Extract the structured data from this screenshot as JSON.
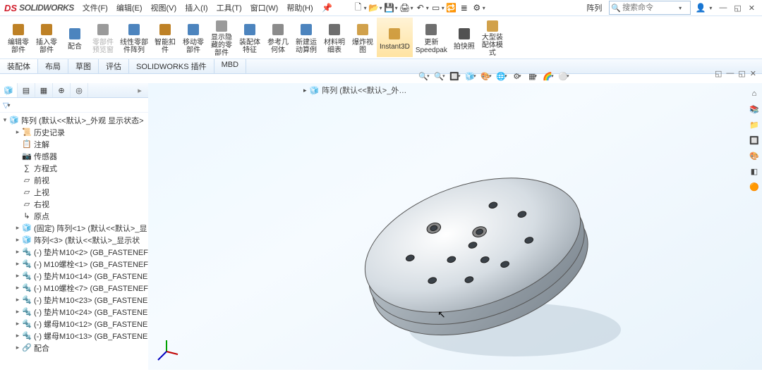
{
  "app": {
    "brand_ds": "DS",
    "brand_name": "SOLIDWORKS"
  },
  "menus": [
    "文件(F)",
    "编辑(E)",
    "视图(V)",
    "插入(I)",
    "工具(T)",
    "窗口(W)",
    "帮助(H)"
  ],
  "title_right": {
    "doc_label": "阵列",
    "search_placeholder": "搜索命令"
  },
  "toolbar": [
    {
      "label": "编辑零\n部件",
      "enabled": true,
      "color": "#b36b00"
    },
    {
      "label": "插入零\n部件",
      "enabled": true,
      "color": "#b36b00"
    },
    {
      "label": "配合",
      "enabled": true,
      "color": "#2d6fb3"
    },
    {
      "label": "零部件\n预览窗",
      "enabled": false,
      "color": "#888"
    },
    {
      "label": "线性零部\n件阵列",
      "enabled": true,
      "color": "#2d6fb3"
    },
    {
      "label": "智能扣\n件",
      "enabled": true,
      "color": "#b36b00"
    },
    {
      "label": "移动零\n部件",
      "enabled": true,
      "color": "#2d6fb3"
    },
    {
      "label": "显示隐\n藏的零\n部件",
      "enabled": true,
      "color": "#888"
    },
    {
      "label": "装配体\n特征",
      "enabled": true,
      "color": "#2d6fb3"
    },
    {
      "label": "参考几\n何体",
      "enabled": true,
      "color": "#777"
    },
    {
      "label": "新建运\n动算例",
      "enabled": true,
      "color": "#2d6fb3"
    },
    {
      "label": "材料明\n细表",
      "enabled": true,
      "color": "#555"
    },
    {
      "label": "爆炸视\n图",
      "enabled": true,
      "color": "#c9902b"
    },
    {
      "label": "Instant3D",
      "enabled": true,
      "color": "#c9902b",
      "highlight": true
    },
    {
      "label": "更新\nSpeedpak",
      "enabled": true,
      "color": "#555"
    },
    {
      "label": "拍快照",
      "enabled": true,
      "color": "#333"
    },
    {
      "label": "大型装\n配体模\n式",
      "enabled": true,
      "color": "#c9902b"
    }
  ],
  "tabs": [
    "装配体",
    "布局",
    "草图",
    "评估",
    "SOLIDWORKS 插件",
    "MBD"
  ],
  "active_tab": "装配体",
  "breadcrumb": "阵列  (默认<<默认>_外…",
  "tree": {
    "root": "阵列 (默认<<默认>_外观 显示状态>",
    "children": [
      {
        "exp": "▸",
        "icon": "📜",
        "label": "历史记录",
        "indent": 1
      },
      {
        "exp": "",
        "icon": "📋",
        "label": "注解",
        "indent": 1
      },
      {
        "exp": "",
        "icon": "📷",
        "label": "传感器",
        "indent": 1
      },
      {
        "exp": "",
        "icon": "∑",
        "label": "方程式",
        "indent": 1
      },
      {
        "exp": "",
        "icon": "▱",
        "label": "前视",
        "indent": 1
      },
      {
        "exp": "",
        "icon": "▱",
        "label": "上视",
        "indent": 1
      },
      {
        "exp": "",
        "icon": "▱",
        "label": "右视",
        "indent": 1
      },
      {
        "exp": "",
        "icon": "↳",
        "label": "原点",
        "indent": 1
      },
      {
        "exp": "▸",
        "icon": "🧊",
        "label": "(固定) 阵列<1> (默认<<默认>_显",
        "indent": 1,
        "yellow": true
      },
      {
        "exp": "▸",
        "icon": "🧊",
        "label": "阵列<3> (默认<<默认>_显示状",
        "indent": 1,
        "yellow": true
      },
      {
        "exp": "▸",
        "icon": "🔩",
        "label": "(-) 垫片M10<2> (GB_FASTENEF",
        "indent": 1
      },
      {
        "exp": "▸",
        "icon": "🔩",
        "label": "(-) M10螺栓<1> (GB_FASTENEF",
        "indent": 1
      },
      {
        "exp": "▸",
        "icon": "🔩",
        "label": "(-) 垫片M10<14> (GB_FASTENE",
        "indent": 1
      },
      {
        "exp": "▸",
        "icon": "🔩",
        "label": "(-) M10螺栓<7> (GB_FASTENEF",
        "indent": 1
      },
      {
        "exp": "▸",
        "icon": "🔩",
        "label": "(-) 垫片M10<23> (GB_FASTENE",
        "indent": 1
      },
      {
        "exp": "▸",
        "icon": "🔩",
        "label": "(-) 垫片M10<24> (GB_FASTENE",
        "indent": 1
      },
      {
        "exp": "▸",
        "icon": "🔩",
        "label": "(-) 螺母M10<12> (GB_FASTENE",
        "indent": 1
      },
      {
        "exp": "▸",
        "icon": "🔩",
        "label": "(-) 螺母M10<13> (GB_FASTENE",
        "indent": 1
      },
      {
        "exp": "▸",
        "icon": "🔗",
        "label": "配合",
        "indent": 1,
        "teal": true
      }
    ]
  },
  "heads_up_icons": [
    "🔍",
    "🔍",
    "🔲",
    "🧊",
    "🎨",
    "🌐",
    "⚙",
    "▦",
    "🌈",
    "⚪"
  ]
}
